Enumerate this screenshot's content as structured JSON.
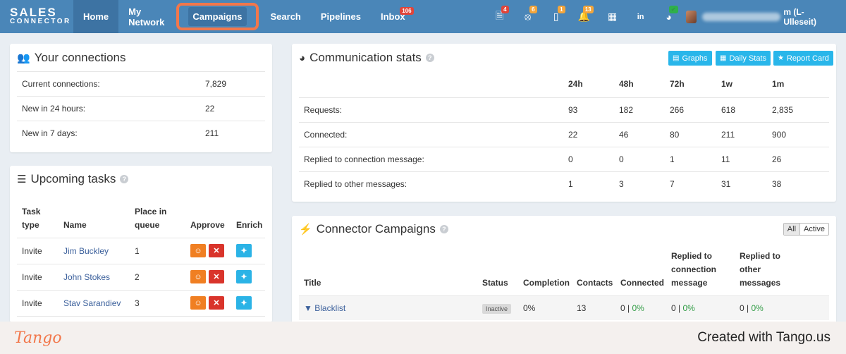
{
  "logo": {
    "line1": "SALES",
    "line2": "CONNECTOR"
  },
  "nav": [
    {
      "label": "Home",
      "state": "active"
    },
    {
      "label": "My Network",
      "state": ""
    },
    {
      "label": "Campaigns",
      "state": "highlight"
    },
    {
      "label": "Search",
      "state": ""
    },
    {
      "label": "Pipelines",
      "state": ""
    },
    {
      "label": "Inbox",
      "state": "",
      "badge": "106"
    }
  ],
  "top_icons": [
    {
      "icon": "document-icon",
      "badge": "4",
      "badge_color": "red"
    },
    {
      "icon": "support-icon",
      "badge": "6",
      "badge_color": "orange"
    },
    {
      "icon": "clipboard-icon",
      "badge": "1",
      "badge_color": "orange"
    },
    {
      "icon": "bell-icon",
      "badge": "13",
      "badge_color": "orange"
    },
    {
      "icon": "calendar-icon",
      "badge": "",
      "badge_color": ""
    },
    {
      "icon": "linkedin-icon",
      "badge": "",
      "badge_color": ""
    },
    {
      "icon": "palette-icon",
      "badge": "✔",
      "badge_color": "green"
    }
  ],
  "user": {
    "suffix": "m (L-Ulleseit)"
  },
  "connections": {
    "title": "Your connections",
    "rows": [
      {
        "label": "Current connections:",
        "value": "7,829"
      },
      {
        "label": "New in 24 hours:",
        "value": "22"
      },
      {
        "label": "New in 7 days:",
        "value": "211"
      }
    ]
  },
  "tasks": {
    "title": "Upcoming tasks",
    "headers": {
      "type": "Task type",
      "name": "Name",
      "queue": "Place in queue",
      "approve": "Approve",
      "enrich": "Enrich"
    },
    "rows": [
      {
        "type": "Invite",
        "name": "Jim Buckley",
        "queue": "1"
      },
      {
        "type": "Invite",
        "name": "John Stokes",
        "queue": "2"
      },
      {
        "type": "Invite",
        "name": "Stav Sarandiev",
        "queue": "3"
      }
    ]
  },
  "stats": {
    "title": "Communication stats",
    "buttons": {
      "graphs": "Graphs",
      "daily": "Daily Stats",
      "report": "Report Card"
    },
    "columns": [
      "24h",
      "48h",
      "72h",
      "1w",
      "1m"
    ],
    "rows": [
      {
        "label": "Requests:",
        "values": [
          "93",
          "182",
          "266",
          "618",
          "2,835"
        ]
      },
      {
        "label": "Connected:",
        "values": [
          "22",
          "46",
          "80",
          "211",
          "900"
        ]
      },
      {
        "label": "Replied to connection message:",
        "values": [
          "0",
          "0",
          "1",
          "11",
          "26"
        ]
      },
      {
        "label": "Replied to other messages:",
        "values": [
          "1",
          "3",
          "7",
          "31",
          "38"
        ]
      }
    ]
  },
  "campaigns": {
    "title": "Connector Campaigns",
    "filter": {
      "all": "All",
      "active": "Active"
    },
    "headers": {
      "title": "Title",
      "status": "Status",
      "completion": "Completion",
      "contacts": "Contacts",
      "connected": "Connected",
      "replied_conn_1": "Replied to",
      "replied_conn_2": "connection",
      "replied_conn_3": "message",
      "replied_other_1": "Replied to",
      "replied_other_2": "other",
      "replied_other_3": "messages"
    },
    "rows": [
      {
        "title": "Blacklist",
        "status": "Inactive",
        "completion": "0%",
        "contacts": "13",
        "connected": "0",
        "connected_pct": "0%",
        "replied_conn": "0",
        "replied_conn_pct": "0%",
        "replied_other": "0",
        "replied_other_pct": "0%"
      }
    ]
  },
  "footer": {
    "brand": "Tango",
    "created": "Created with Tango.us"
  }
}
